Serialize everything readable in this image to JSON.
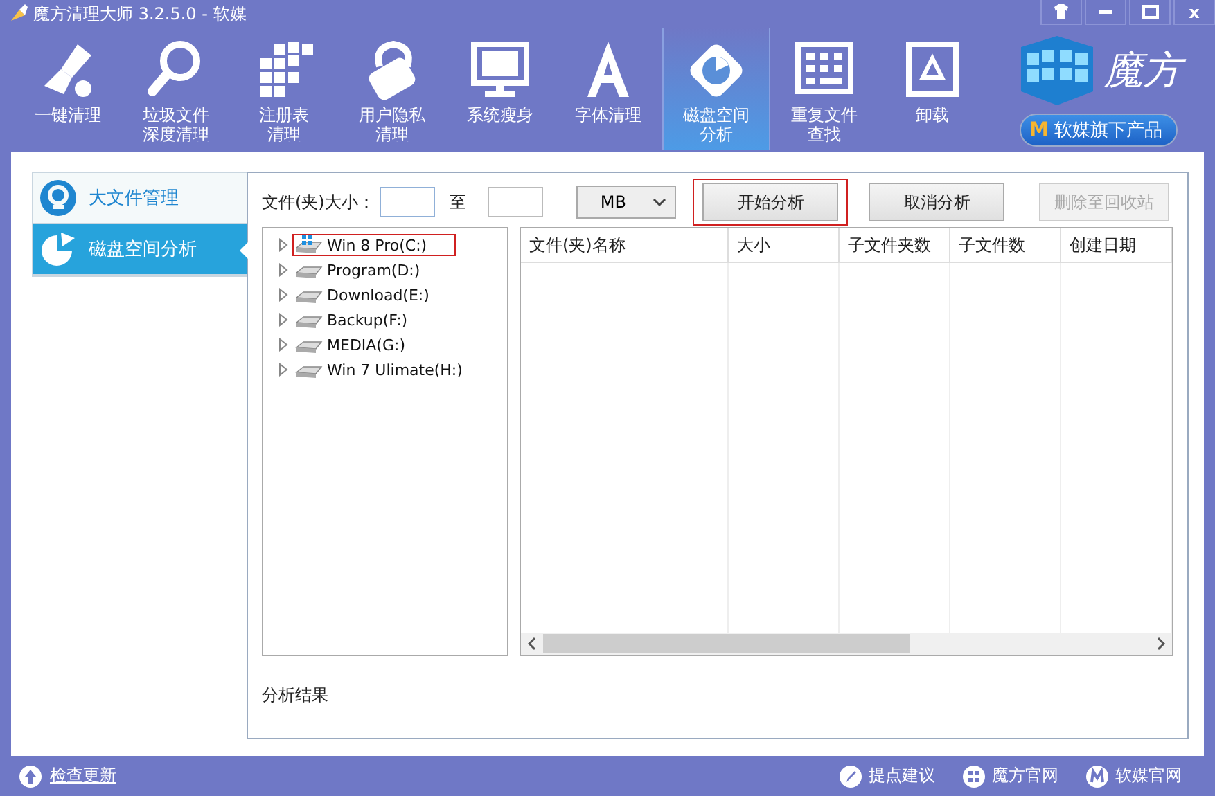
{
  "window": {
    "title": "魔方清理大师 3.2.5.0 - 软媒",
    "controls": [
      {
        "kind": "skin"
      },
      {
        "kind": "minimize"
      },
      {
        "kind": "maximize"
      },
      {
        "kind": "close",
        "label": "x"
      }
    ]
  },
  "toolbar": [
    {
      "label": "一键清理",
      "kind": "brush",
      "selected": false
    },
    {
      "label": [
        "垃圾文件",
        "深度清理"
      ],
      "kind": "search",
      "selected": false
    },
    {
      "label": [
        "注册表",
        "清理"
      ],
      "kind": "blocks",
      "selected": false
    },
    {
      "label": [
        "用户隐私",
        "清理"
      ],
      "kind": "lock",
      "selected": false
    },
    {
      "label": "系统瘦身",
      "kind": "monitor",
      "selected": false
    },
    {
      "label": "字体清理",
      "kind": "font",
      "selected": false
    },
    {
      "label": [
        "磁盘空间",
        "分析"
      ],
      "kind": "disk",
      "selected": true
    },
    {
      "label": [
        "重复文件",
        "查找"
      ],
      "kind": "grid",
      "selected": false
    },
    {
      "label": "卸载",
      "kind": "recycle",
      "selected": false
    }
  ],
  "brand": {
    "name": "魔方",
    "badge": "M",
    "product": "软媒旗下产品"
  },
  "sidebar": [
    {
      "label": "大文件管理",
      "kind": "search",
      "selected": false
    },
    {
      "label": "磁盘空间分析",
      "kind": "pie",
      "selected": true
    }
  ],
  "filter": {
    "size_label": "文件(夹)大小：",
    "to_label": "至",
    "unit": "MB"
  },
  "buttons": [
    {
      "label": "开始分析",
      "disabled": false,
      "highlighted": true
    },
    {
      "label": "取消分析",
      "disabled": false,
      "highlighted": false
    },
    {
      "label": "删除至回收站",
      "disabled": true,
      "highlighted": false
    }
  ],
  "tree": [
    {
      "label": "Win 8 Pro(C:)",
      "kind": "system",
      "expanded": false,
      "highlighted": true
    },
    {
      "label": "Program(D:)",
      "kind": "drive",
      "expanded": false,
      "highlighted": false
    },
    {
      "label": "Download(E:)",
      "kind": "drive",
      "expanded": false,
      "highlighted": false
    },
    {
      "label": "Backup(F:)",
      "kind": "drive",
      "expanded": false,
      "highlighted": false
    },
    {
      "label": "MEDIA(G:)",
      "kind": "drive",
      "expanded": false,
      "highlighted": false
    },
    {
      "label": "Win 7 Ulimate(H:)",
      "kind": "drive",
      "expanded": false,
      "highlighted": false
    }
  ],
  "table": {
    "columns": [
      "文件(夹)名称",
      "大小",
      "子文件夹数",
      "子文件数",
      "创建日期"
    ]
  },
  "result_label": "分析结果",
  "status_bar": {
    "update": "检查更新",
    "links": [
      {
        "label": "提点建议",
        "kind": "pen"
      },
      {
        "label": "魔方官网",
        "kind": "grid"
      },
      {
        "label": "软媒官网",
        "kind": "m"
      }
    ]
  }
}
